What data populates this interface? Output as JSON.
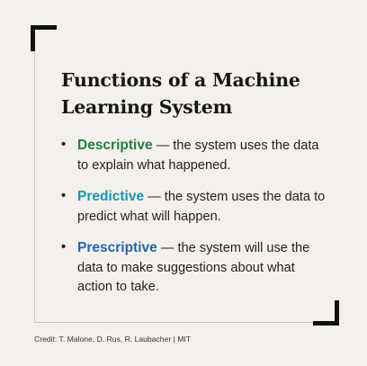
{
  "title": "Functions of a Machine Learning System",
  "items": [
    {
      "term": "Descriptive",
      "text": " — the system uses the data to explain what happened.",
      "color": "#1f7f45"
    },
    {
      "term": "Predictive",
      "text": " — the system uses the data to predict what will happen.",
      "color": "#1996b3"
    },
    {
      "term": "Prescriptive",
      "text": " — the system will use the data to make suggestions about what action to take.",
      "color": "#1f68b0"
    }
  ],
  "bullet": "•",
  "credit": "Credit: T. Malone, D. Rus, R. Laubacher | MIT",
  "colors": {
    "background": "#f4f1ec",
    "frame_line": "#c9c6c1",
    "corner_marks": "#111111"
  }
}
